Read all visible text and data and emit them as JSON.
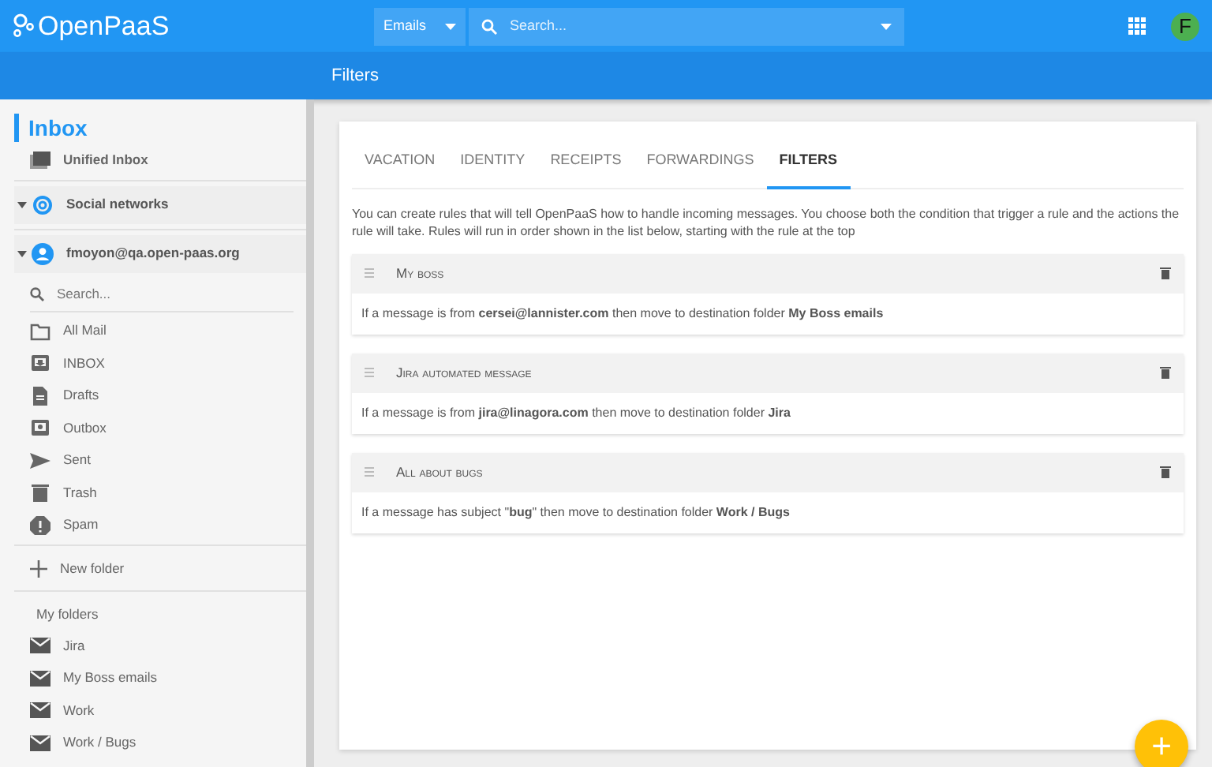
{
  "header": {
    "logo": "OpenPaaS",
    "search_scope": "Emails",
    "search_placeholder": "Search...",
    "avatar": "F"
  },
  "subheader": {
    "title": "Filters"
  },
  "sidebar": {
    "title": "Inbox",
    "unified": "Unified Inbox",
    "accounts": [
      {
        "label": "Social networks",
        "kind": "social"
      },
      {
        "label": "fmoyon@qa.open-paas.org",
        "kind": "user"
      }
    ],
    "search_placeholder": "Search...",
    "folders": [
      {
        "label": "All Mail",
        "kind": "all"
      },
      {
        "label": "INBOX",
        "kind": "inbox"
      },
      {
        "label": "Drafts",
        "kind": "drafts"
      },
      {
        "label": "Outbox",
        "kind": "outbox"
      },
      {
        "label": "Sent",
        "kind": "sent"
      },
      {
        "label": "Trash",
        "kind": "trash"
      },
      {
        "label": "Spam",
        "kind": "spam"
      }
    ],
    "new_folder": "New folder",
    "my_folders_title": "My folders",
    "my_folders": [
      "Jira",
      "My Boss emails",
      "Work",
      "Work / Bugs"
    ]
  },
  "tabs": [
    {
      "label": "VACATION",
      "selected": false
    },
    {
      "label": "IDENTITY",
      "selected": false
    },
    {
      "label": "RECEIPTS",
      "selected": false
    },
    {
      "label": "FORWARDINGS",
      "selected": false
    },
    {
      "label": "FILTERS",
      "selected": true
    }
  ],
  "description": "You can create rules that will tell OpenPaaS how to handle incoming messages. You choose both the condition that trigger a rule and the actions the rule will take. Rules will run in order shown in the list below, starting with the rule at the top",
  "filters": [
    {
      "name": "My boss",
      "rule": "If a message is from **cersei@lannister.com** then move to destination folder **My Boss emails**"
    },
    {
      "name": "Jira automated message",
      "rule": "If a message is from **jira@linagora.com** then move to destination folder **Jira**"
    },
    {
      "name": "All about bugs",
      "rule": "If a message has subject \"**bug**\" then move to destination folder **Work / Bugs**"
    }
  ],
  "fab": "+"
}
